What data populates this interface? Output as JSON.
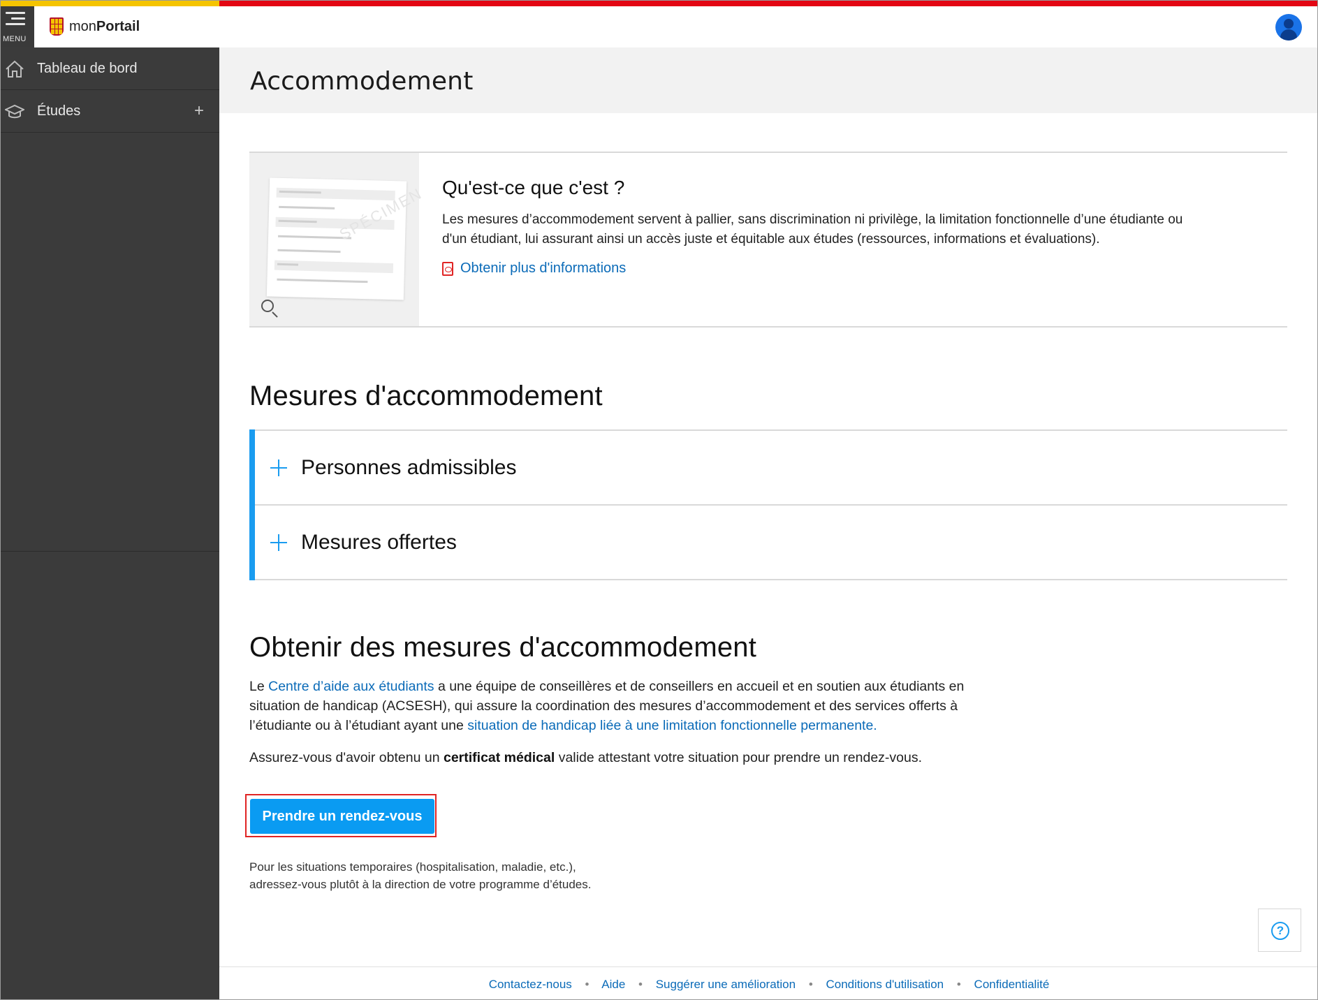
{
  "header": {
    "menu_label": "MENU",
    "brand_prefix": "mon",
    "brand_bold": "Portail"
  },
  "sidebar": {
    "items": [
      {
        "label": "Tableau de bord",
        "icon": "home-icon"
      },
      {
        "label": "Études",
        "icon": "graduation-cap-icon",
        "expand": "+"
      }
    ]
  },
  "page": {
    "title": "Accommodement"
  },
  "info": {
    "heading": "Qu'est-ce que c'est ?",
    "text": "Les mesures d’accommodement servent à pallier, sans discrimination ni privilège, la limitation fonctionnelle d’une étudiante ou d'un étudiant, lui assurant ainsi un accès juste et équitable aux études (ressources, informations et évaluations).",
    "link": "Obtenir plus d'informations"
  },
  "measures": {
    "heading": "Mesures d'accommodement",
    "items": [
      "Personnes admissibles",
      "Mesures offertes"
    ]
  },
  "obtain": {
    "heading": "Obtenir des mesures d'accommodement",
    "p1_before": "Le ",
    "p1_link1": "Centre d’aide aux étudiants",
    "p1_middle": " a une équipe de conseillères et de conseillers en accueil et en soutien aux étudiants en situation de handicap (ACSESH), qui assure la coordination des mesures d’accommodement et des services offerts à l’étudiante ou à l’étudiant ayant une ",
    "p1_link2": "situation de handicap liée à une limitation fonctionnelle permanente.",
    "p2_before": "Assurez-vous d'avoir obtenu un ",
    "p2_strong": "certificat médical",
    "p2_after": " valide attestant votre situation pour prendre un rendez-vous.",
    "button": "Prendre un rendez-vous",
    "note_line1": "Pour les situations temporaires (hospitalisation, maladie, etc.),",
    "note_line2": "adressez-vous plutôt à la direction de votre programme d’études."
  },
  "footer": {
    "links": [
      "Contactez-nous",
      "Aide",
      "Suggérer une amélioration",
      "Conditions d'utilisation",
      "Confidentialité"
    ],
    "separator": "•"
  },
  "colors": {
    "accent": "#1a9cf0",
    "link": "#0b6bb8",
    "sidebar": "#3b3b3b",
    "stripe_yellow": "#f5c400",
    "stripe_red": "#e30613"
  }
}
